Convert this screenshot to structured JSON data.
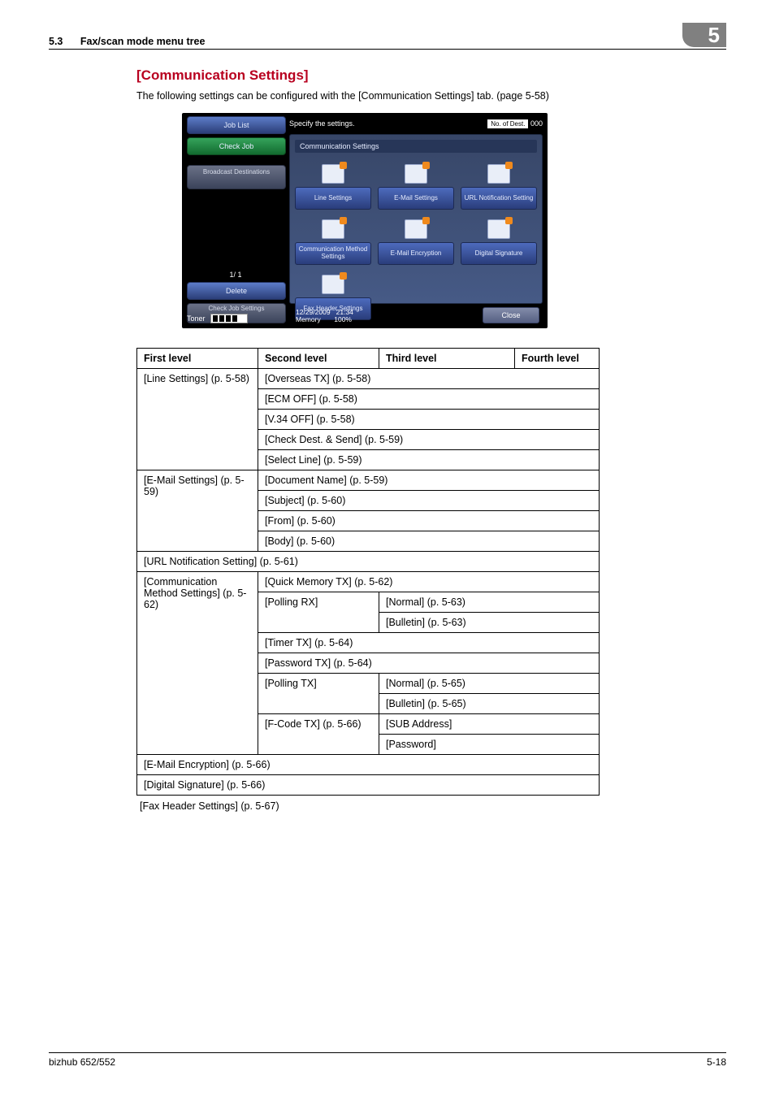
{
  "header": {
    "section_number": "5.3",
    "section_title": "Fax/scan mode menu tree",
    "chapter_digit": "5"
  },
  "heading": "[Communication Settings]",
  "intro": "The following settings can be configured with the [Communication Settings] tab. (page 5-58)",
  "panel": {
    "prompt": "Specify the settings.",
    "dest_label": "No. of Dest.",
    "dest_count": "000",
    "side": {
      "job_list": "Job List",
      "check_job": "Check Job",
      "broadcast": "Broadcast Destinations",
      "pager": "1/ 1",
      "delete": "Delete",
      "check_settings": "Check Job Settings"
    },
    "main_title": "Communication Settings",
    "tiles": {
      "line": "Line Settings",
      "email": "E-Mail Settings",
      "url": "URL Notification Setting",
      "method": "Communication Method Settings",
      "encrypt": "E-Mail Encryption",
      "signature": "Digital Signature",
      "faxheader": "Fax Header Settings"
    },
    "close": "Close",
    "toner": "Toner",
    "datetime_date": "12/29/2009",
    "datetime_time": "21:34",
    "memory": "Memory",
    "memory_pct": "100%"
  },
  "table": {
    "h1": "First level",
    "h2": "Second level",
    "h3": "Third level",
    "h4": "Fourth level",
    "line_settings": "[Line Settings] (p. 5-58)",
    "line_r1": "[Overseas TX] (p. 5-58)",
    "line_r2": "[ECM OFF] (p. 5-58)",
    "line_r3": "[V.34 OFF] (p. 5-58)",
    "line_r4": "[Check Dest. & Send] (p. 5-59)",
    "line_r5": "[Select Line] (p. 5-59)",
    "email_settings": "[E-Mail Settings] (p. 5-59)",
    "email_r1": "[Document Name] (p. 5-59)",
    "email_r2": "[Subject] (p. 5-60)",
    "email_r3": "[From] (p. 5-60)",
    "email_r4": "[Body] (p. 5-60)",
    "url_row": "[URL Notification Setting] (p. 5-61)",
    "comm_method": "[Communication Method Settings] (p. 5-62)",
    "cm_r1": "[Quick Memory TX] (p. 5-62)",
    "cm_pollrx": "[Polling RX]",
    "cm_pollrx_n": "[Normal] (p. 5-63)",
    "cm_pollrx_b": "[Bulletin] (p. 5-63)",
    "cm_timer": "[Timer TX] (p. 5-64)",
    "cm_pwd": "[Password TX] (p. 5-64)",
    "cm_polltx": "[Polling TX]",
    "cm_polltx_n": "[Normal] (p. 5-65)",
    "cm_polltx_b": "[Bulletin] (p. 5-65)",
    "cm_fcode": "[F-Code TX] (p. 5-66)",
    "cm_fcode_sub": "[SUB Address]",
    "cm_fcode_pwd": "[Password]",
    "enc_row": "[E-Mail Encryption] (p. 5-66)",
    "sig_row": "[Digital Signature] (p. 5-66)"
  },
  "below_table": "[Fax Header Settings] (p. 5-67)",
  "footer": {
    "left": "bizhub 652/552",
    "right": "5-18"
  }
}
